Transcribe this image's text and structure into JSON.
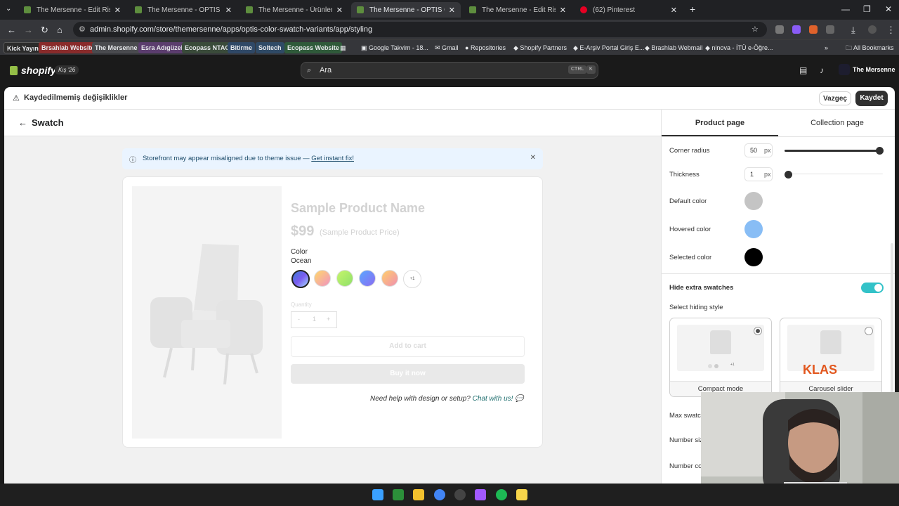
{
  "browser": {
    "tabs": [
      {
        "label": "The Mersenne - Edit Rise · Shopify",
        "active": false
      },
      {
        "label": "The Mersenne - OPTIS Color Swatch",
        "active": false
      },
      {
        "label": "The Mersenne - Ürünler - No.2",
        "active": false
      },
      {
        "label": "The Mersenne - OPTIS Color Swatch",
        "active": true
      },
      {
        "label": "The Mersenne - Edit Rise · Shopify",
        "active": false
      },
      {
        "label": "(62) Pinterest",
        "active": false
      }
    ],
    "url": "admin.shopify.com/store/themersenne/apps/optis-color-swatch-variants/app/styling",
    "bookmarks": [
      "Kick Yayın",
      "Brsahlab Website",
      "The Mersenne",
      "Esra Adıgüzel",
      "Ecopass NTAG",
      "Bitirme",
      "Soltech",
      "Ecopass Website",
      "Google Takvim - 18...",
      "Gmail",
      "Repositories",
      "Shopify Partners",
      "E-Arşiv Portal Giriş E...",
      "Brashlab Webmail",
      "ninova - İTÜ e-Öğre..."
    ],
    "all_bookmarks": "All Bookmarks"
  },
  "shopify": {
    "brand": "shopify",
    "badge": "Kış '26",
    "search_placeholder": "Ara",
    "kbd_ctrl": "CTRL",
    "kbd_k": "K",
    "store_name": "The Mersenne"
  },
  "savebar": {
    "message": "Kaydedilmemiş değişiklikler",
    "discard": "Vazgeç",
    "save": "Kaydet"
  },
  "page": {
    "title": "Swatch",
    "banner": {
      "text": "Storefront may appear misaligned due to theme issue — ",
      "link": "Get instant fix!"
    },
    "product": {
      "name": "Sample Product Name",
      "price": "$99",
      "price_note": "(Sample Product Price)",
      "option_label": "Color",
      "option_value": "Ocean",
      "more_swatches": "+1",
      "quantity_label": "Quantity",
      "quantity": "1",
      "minus": "-",
      "plus": "+",
      "add_to_cart": "Add to cart",
      "buy_now": "Buy it now",
      "help_text": "Need help with design or setup?",
      "help_link": "Chat with us!"
    }
  },
  "panel": {
    "tabs": [
      "Product page",
      "Collection page"
    ],
    "active_tab": "Product page",
    "corner_radius": {
      "label": "Corner radius",
      "value": "50",
      "unit": "px",
      "slider_fraction": 1.0
    },
    "thickness": {
      "label": "Thickness",
      "value": "1",
      "unit": "px",
      "slider_fraction": 0.0
    },
    "default_color": {
      "label": "Default color",
      "color": "#c4c4c4"
    },
    "hovered_color": {
      "label": "Hovered color",
      "color": "#88bdf5"
    },
    "selected_color": {
      "label": "Selected color",
      "color": "#000000"
    },
    "hide_extra": {
      "label": "Hide extra swatches",
      "on": true
    },
    "hiding_style_label": "Select hiding style",
    "options": [
      {
        "label": "Compact mode",
        "selected": true
      },
      {
        "label": "Carousel slider",
        "selected": false
      }
    ],
    "more_badge": "+1",
    "klas": "KLAS",
    "max_swatches_label": "Max swatch",
    "number_size_label": "Number siz",
    "number_color_label": "Number co"
  },
  "colors": {
    "accent_toggle": "#33c2c8",
    "shopify_green": "#95bf47"
  }
}
